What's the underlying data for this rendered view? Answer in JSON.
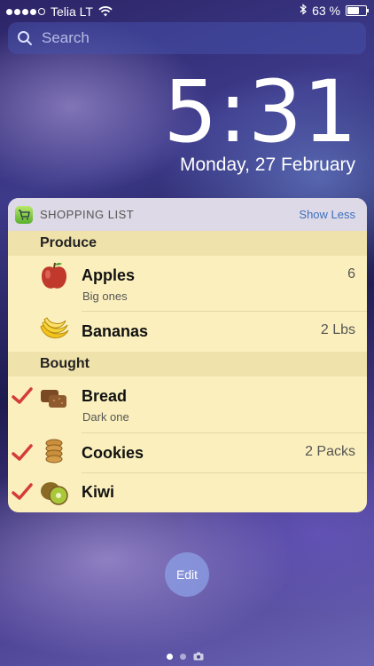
{
  "status": {
    "carrier": "Telia LT",
    "battery": "63 %",
    "battery_level": 0.63,
    "signal_dots": 5,
    "signal_filled": 4
  },
  "search": {
    "placeholder": "Search"
  },
  "lockscreen": {
    "time": "5:31",
    "date": "Monday, 27 February"
  },
  "widget": {
    "title": "SHOPPING LIST",
    "toggle_label": "Show Less",
    "sections": [
      {
        "label": "Produce",
        "items": [
          {
            "name": "Apples",
            "note": "Big ones",
            "qty": "6",
            "icon": "apple-icon",
            "checked": false
          },
          {
            "name": "Bananas",
            "note": "",
            "qty": "2 Lbs",
            "icon": "banana-icon",
            "checked": false
          }
        ]
      },
      {
        "label": "Bought",
        "items": [
          {
            "name": "Bread",
            "note": "Dark one",
            "qty": "",
            "icon": "bread-icon",
            "checked": true
          },
          {
            "name": "Cookies",
            "note": "",
            "qty": "2 Packs",
            "icon": "cookies-icon",
            "checked": true
          },
          {
            "name": "Kiwi",
            "note": "",
            "qty": "",
            "icon": "kiwi-icon",
            "checked": true
          }
        ]
      }
    ]
  },
  "edit_label": "Edit",
  "colors": {
    "widget_bg": "#fbf0bd",
    "section_bg": "#efe2aa",
    "accent": "#3d6fbf",
    "check": "#d43c3c"
  }
}
